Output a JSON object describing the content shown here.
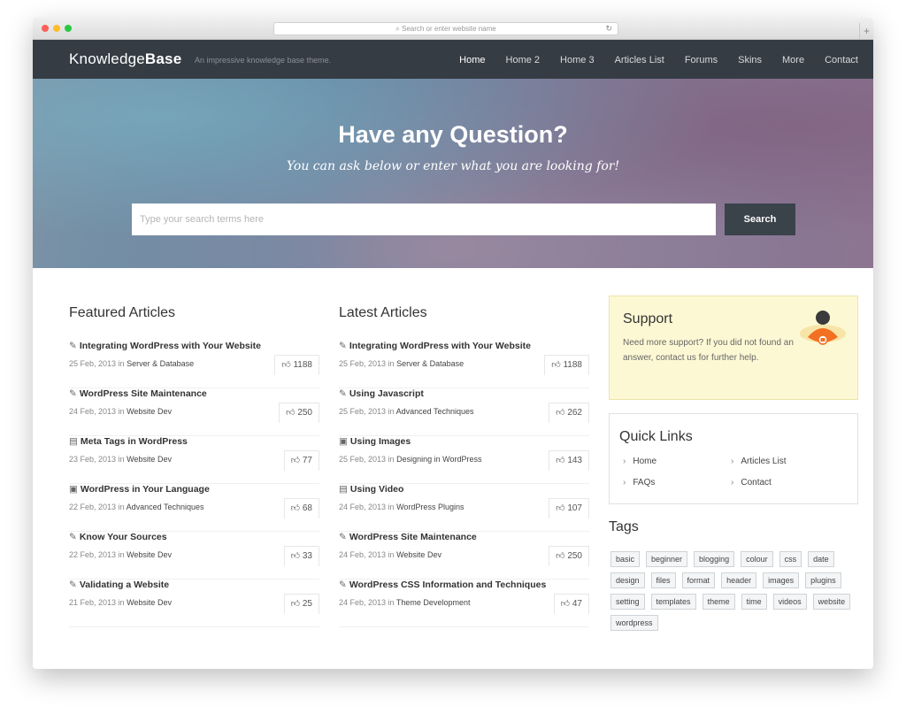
{
  "browser": {
    "url_placeholder": "Search or enter website name",
    "reload": "↻",
    "new_tab": "+"
  },
  "site": {
    "logo_light": "Knowledge",
    "logo_bold": "Base",
    "tagline": "An impressive knowledge base theme.",
    "menu": [
      "Home",
      "Home 2",
      "Home 3",
      "Articles List",
      "Forums",
      "Skins",
      "More",
      "Contact"
    ]
  },
  "hero": {
    "title": "Have any Question?",
    "subtitle": "You can ask below or enter what you are looking for!",
    "search_placeholder": "Type your search terms here",
    "search_button": "Search"
  },
  "featured": {
    "heading": "Featured Articles",
    "articles": [
      {
        "icon": "edit-icon",
        "glyph": "✎",
        "title": "Integrating WordPress with Your Website",
        "date": "25 Feb, 2013",
        "in": "in",
        "category": "Server & Database",
        "likes": "1188"
      },
      {
        "icon": "edit-icon",
        "glyph": "✎",
        "title": "WordPress Site Maintenance",
        "date": "24 Feb, 2013",
        "in": "in",
        "category": "Website Dev",
        "likes": "250"
      },
      {
        "icon": "film-icon",
        "glyph": "▤",
        "title": "Meta Tags in WordPress",
        "date": "23 Feb, 2013",
        "in": "in",
        "category": "Website Dev",
        "likes": "77"
      },
      {
        "icon": "image-icon",
        "glyph": "▣",
        "title": "WordPress in Your Language",
        "date": "22 Feb, 2013",
        "in": "in",
        "category": "Advanced Techniques",
        "likes": "68"
      },
      {
        "icon": "edit-icon",
        "glyph": "✎",
        "title": "Know Your Sources",
        "date": "22 Feb, 2013",
        "in": "in",
        "category": "Website Dev",
        "likes": "33"
      },
      {
        "icon": "edit-icon",
        "glyph": "✎",
        "title": "Validating a Website",
        "date": "21 Feb, 2013",
        "in": "in",
        "category": "Website Dev",
        "likes": "25"
      }
    ]
  },
  "latest": {
    "heading": "Latest Articles",
    "articles": [
      {
        "icon": "edit-icon",
        "glyph": "✎",
        "title": "Integrating WordPress with Your Website",
        "date": "25 Feb, 2013",
        "in": "in",
        "category": "Server & Database",
        "likes": "1188"
      },
      {
        "icon": "edit-icon",
        "glyph": "✎",
        "title": "Using Javascript",
        "date": "25 Feb, 2013",
        "in": "in",
        "category": "Advanced Techniques",
        "likes": "262"
      },
      {
        "icon": "image-icon",
        "glyph": "▣",
        "title": "Using Images",
        "date": "25 Feb, 2013",
        "in": "in",
        "category": "Designing in WordPress",
        "likes": "143"
      },
      {
        "icon": "film-icon",
        "glyph": "▤",
        "title": "Using Video",
        "date": "24 Feb, 2013",
        "in": "in",
        "category": "WordPress Plugins",
        "likes": "107"
      },
      {
        "icon": "edit-icon",
        "glyph": "✎",
        "title": "WordPress Site Maintenance",
        "date": "24 Feb, 2013",
        "in": "in",
        "category": "Website Dev",
        "likes": "250"
      },
      {
        "icon": "edit-icon",
        "glyph": "✎",
        "title": "WordPress CSS Information and Techniques",
        "date": "24 Feb, 2013",
        "in": "in",
        "category": "Theme Development",
        "likes": "47"
      }
    ]
  },
  "support": {
    "heading": "Support",
    "text": "Need more support? If you did not found an answer, contact us for further help."
  },
  "quick_links": {
    "heading": "Quick Links",
    "links": [
      "Home",
      "Articles List",
      "FAQs",
      "Contact"
    ]
  },
  "tags": {
    "heading": "Tags",
    "items": [
      "basic",
      "beginner",
      "blogging",
      "colour",
      "css",
      "date",
      "design",
      "files",
      "format",
      "header",
      "images",
      "plugins",
      "setting",
      "templates",
      "theme",
      "time",
      "videos",
      "website",
      "wordpress"
    ]
  },
  "icons": {
    "like": "thumbs-up-icon",
    "chevron": "chevron-right-icon"
  },
  "colors": {
    "nav_bg": "#363c44",
    "button_bg": "#3a424a",
    "support_bg": "#fdf8d4"
  }
}
